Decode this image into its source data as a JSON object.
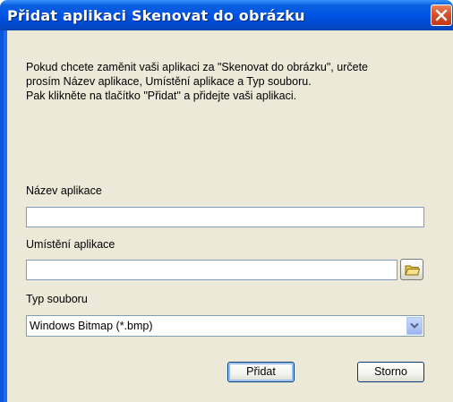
{
  "window": {
    "title": "Přidat aplikaci Skenovat do obrázku"
  },
  "description": {
    "line1": "Pokud chcete zaměnit vaši aplikaci za \"Skenovat do obrázku\", určete",
    "line2": "prosím Název aplikace, Umístění aplikace a Typ souboru.",
    "line3": "Pak klikněte na tlačítko \"Přidat\" a přidejte vaši aplikaci."
  },
  "fields": {
    "app_name_label": "Název aplikace",
    "app_name_value": "",
    "app_location_label": "Umístění aplikace",
    "app_location_value": "",
    "file_type_label": "Typ souboru",
    "file_type_value": "Windows Bitmap (*.bmp)"
  },
  "buttons": {
    "add": "Přidat",
    "cancel": "Storno"
  },
  "icons": {
    "close": "close-icon",
    "browse": "folder-icon",
    "dropdown": "chevron-down-icon"
  },
  "colors": {
    "titlebar": "#0054e3",
    "close_button": "#d6502b",
    "dialog_background": "#ece9d8"
  }
}
